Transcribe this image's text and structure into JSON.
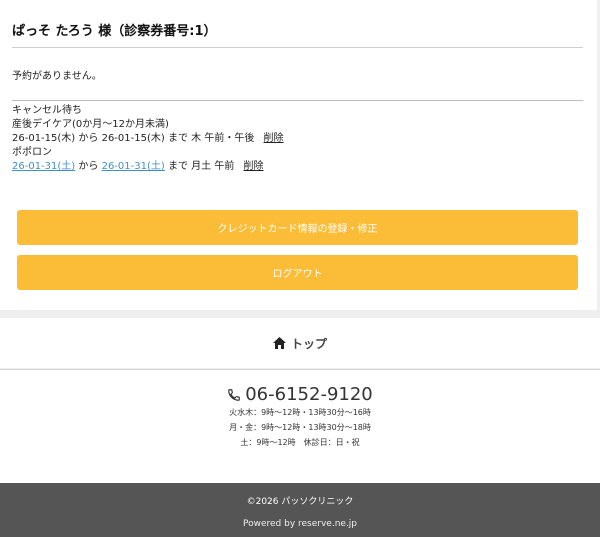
{
  "user": {
    "title": "ぱっそ たろう 様（診察券番号:1）"
  },
  "reservations": {
    "empty_message": "予約がありません。"
  },
  "waitlist": {
    "heading": "キャンセル待ち",
    "entries": [
      {
        "name": "産後デイケア(0か月〜12か月未満)",
        "date_from": "26-01-15(木)",
        "from_label": "から",
        "date_to": "26-01-15(木)",
        "to_label": "まで",
        "slots": "木 午前・午後",
        "delete_label": "削除"
      },
      {
        "name": "ポポロン",
        "date_from": "26-01-31(土)",
        "from_label": "から",
        "date_to": "26-01-31(土)",
        "to_label": "まで",
        "slots": "月土 午前",
        "delete_label": "削除"
      }
    ]
  },
  "buttons": {
    "credit_card": "クレジットカード情報の登録・修正",
    "logout": "ログアウト"
  },
  "nav": {
    "top_label": "トップ"
  },
  "contact": {
    "phone": "06-6152-9120",
    "hours": [
      "火水木：9時〜12時・13時30分〜16時",
      "月・金：9時〜12時・13時30分〜18時",
      "土：9時〜12時　休診日：日・祝"
    ]
  },
  "footer": {
    "copyright": "©2026 パッソクリニック",
    "powered_by": "Powered by reserve.ne.jp"
  },
  "colors": {
    "accent": "#fbbd37",
    "link": "#3d8fd0",
    "footer_bg": "#555555"
  }
}
